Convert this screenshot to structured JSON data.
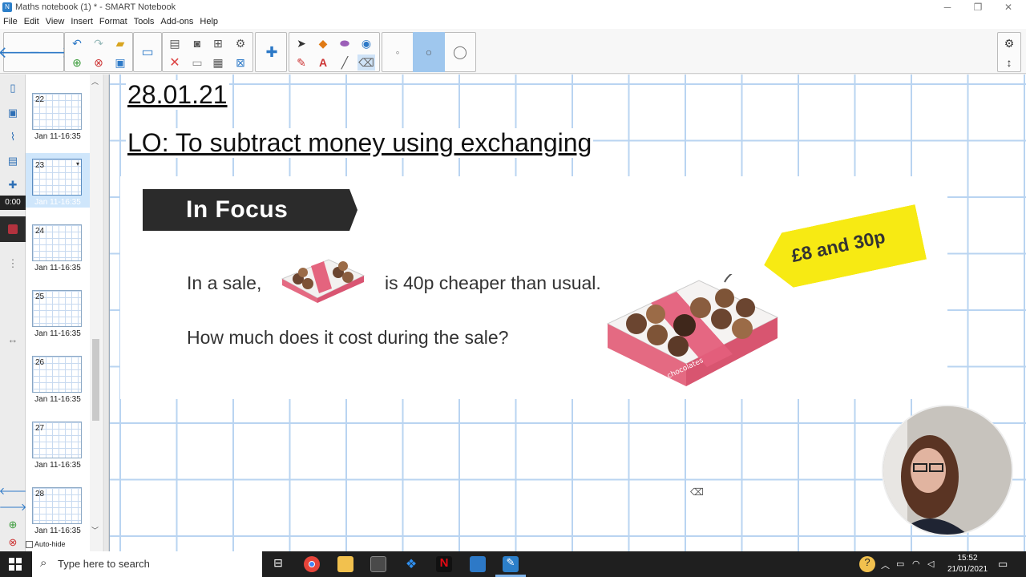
{
  "window": {
    "title": "Maths notebook (1) * - SMART Notebook"
  },
  "menu": {
    "items": [
      "File",
      "Edit",
      "View",
      "Insert",
      "Format",
      "Tools",
      "Add-ons",
      "Help"
    ]
  },
  "recorder": {
    "time": "0:00"
  },
  "slides": [
    {
      "number": "22",
      "date": "Jan 11-16:35"
    },
    {
      "number": "23",
      "date": "Jan 11-16:35"
    },
    {
      "number": "24",
      "date": "Jan 11-16:35"
    },
    {
      "number": "25",
      "date": "Jan 11-16:35"
    },
    {
      "number": "26",
      "date": "Jan 11-16:35"
    },
    {
      "number": "27",
      "date": "Jan 11-16:35"
    },
    {
      "number": "28",
      "date": "Jan 11-16:35"
    }
  ],
  "sorter": {
    "autohide_label": "Auto-hide"
  },
  "page": {
    "date": "28.01.21",
    "lo": "LO: To subtract money using exchanging",
    "infocus": {
      "banner": "In Focus",
      "line1a": "In a sale,",
      "line1b": "is 40p cheaper than usual.",
      "line2": "How much does it cost during the sale?",
      "price_tag": "£8 and 30p",
      "box_label": "chocolates"
    }
  },
  "taskbar": {
    "search_placeholder": "Type here to search",
    "time": "15:52",
    "date": "21/01/2021"
  },
  "colors": {
    "accent": "#2c7fc9",
    "grid": "#b9d4f1",
    "tag": "#f7ea13",
    "banner": "#2b2b2b"
  }
}
